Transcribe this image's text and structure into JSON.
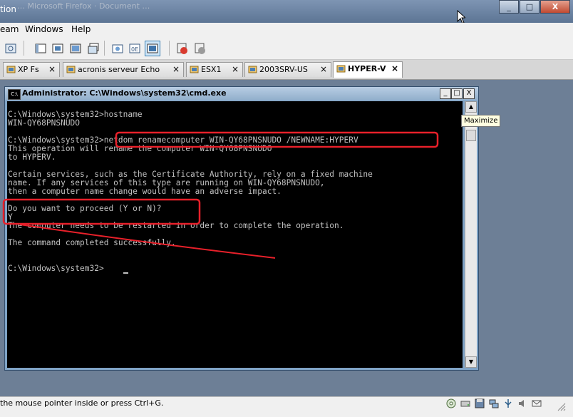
{
  "window": {
    "title": "tion",
    "blurred_title": "… Microsoft Firefox · Document …",
    "buttons": {
      "minimize": "_",
      "maximize": "□",
      "close": "X"
    }
  },
  "menubar": {
    "items": [
      "eam",
      "Windows",
      "Help"
    ]
  },
  "toolbar": {
    "icons": [
      "vm-properties-icon",
      "view-normal-icon",
      "view-full-icon",
      "view-unity-icon",
      "view-quick-switch-icon",
      "snapshot-icon",
      "clone-icon",
      "fit-guest-icon",
      "power-off-icon",
      "power-cycle-icon"
    ]
  },
  "tabs": [
    {
      "label": "XP Fs",
      "close": "×",
      "active": false
    },
    {
      "label": "acronis serveur Echo",
      "close": "×",
      "active": false
    },
    {
      "label": "ESX1",
      "close": "×",
      "active": false
    },
    {
      "label": "2003SRV-US",
      "close": "×",
      "active": false
    },
    {
      "label": "HYPER-V",
      "close": "×",
      "active": true
    }
  ],
  "cmd": {
    "title": "Administrator: C:\\Windows\\system32\\cmd.exe",
    "icon_label": "C:\\",
    "buttons": {
      "minimize": "_",
      "maximize": "□",
      "close": "X"
    },
    "lines": [
      "C:\\Windows\\system32>hostname",
      "WIN-QY68PNSNUDO",
      "",
      "C:\\Windows\\system32>netdom renamecomputer WIN-QY68PNSNUDO /NEWNAME:HYPERV",
      "This operation will rename the computer WIN-QY68PNSNUDO",
      "to HYPERV.",
      "",
      "Certain services, such as the Certificate Authority, rely on a fixed machine",
      "name. If any services of this type are running on WIN-QY68PNSNUDO,",
      "then a computer name change would have an adverse impact.",
      "",
      "Do you want to proceed (Y or N)?",
      "Y",
      "The computer needs to be restarted in order to complete the operation.",
      "",
      "The command completed successfully.",
      "",
      "",
      "C:\\Windows\\system32>"
    ],
    "scroll": {
      "up": "▲",
      "down": "▼"
    }
  },
  "tooltip": {
    "text": "Maximize"
  },
  "statusbar": {
    "text": "the mouse pointer inside or press Ctrl+G.",
    "icons": [
      "cd-drive-icon",
      "hard-disk-icon",
      "floppy-icon",
      "network-icon",
      "usb-icon",
      "sound-icon",
      "message-icon"
    ]
  },
  "colors": {
    "annotation": "#e8202a",
    "console_bg": "#000000",
    "console_fg": "#c0c0c0"
  }
}
